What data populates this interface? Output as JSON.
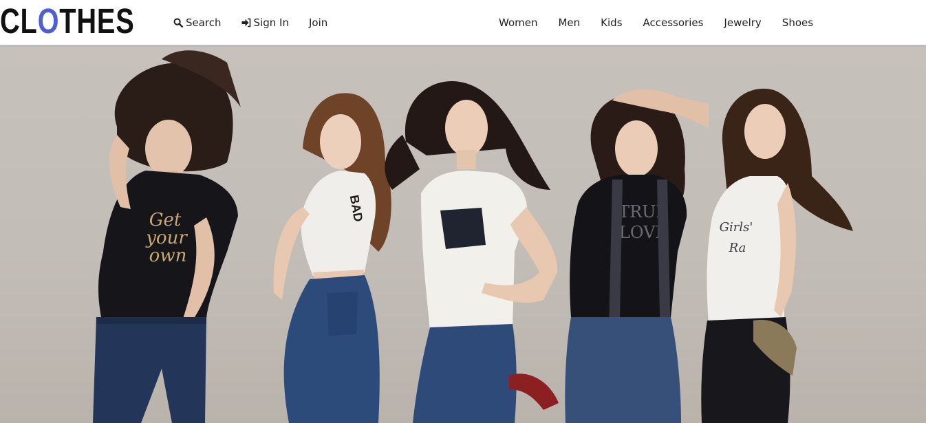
{
  "brand": {
    "logo_prefix": "CL",
    "logo_accent": "O",
    "logo_suffix": "THES",
    "accent_color": "#4f5fd1"
  },
  "nav_left": [
    {
      "label": "Search",
      "icon": "search-icon"
    },
    {
      "label": "Sign In",
      "icon": "sign-in-icon"
    },
    {
      "label": "Join"
    }
  ],
  "nav_right": [
    {
      "label": "Women"
    },
    {
      "label": "Men"
    },
    {
      "label": "Kids"
    },
    {
      "label": "Accessories"
    },
    {
      "label": "Jewelry"
    },
    {
      "label": "Shoes"
    }
  ],
  "hero": {
    "image": "hero-photo",
    "shirt_texts": [
      "Get your own",
      "TRUE LOVE"
    ]
  }
}
